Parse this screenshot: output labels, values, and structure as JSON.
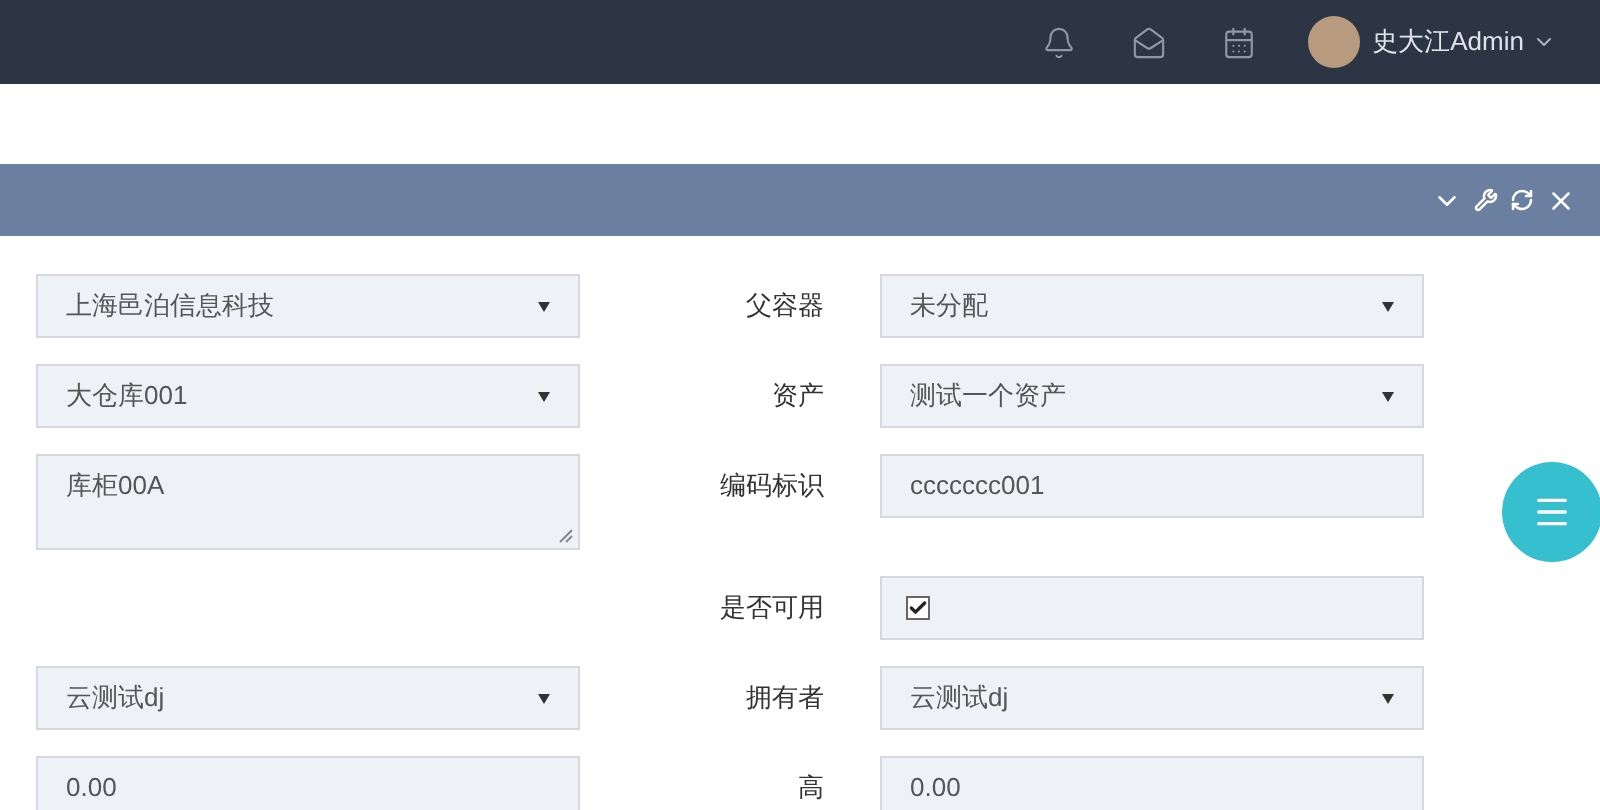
{
  "top_bar": {
    "user_name": "史大江Admin"
  },
  "form": {
    "rows": [
      {
        "left": {
          "kind": "select",
          "value": "上海邑泊信息科技"
        },
        "right": {
          "label": "父容器",
          "kind": "select",
          "value": "未分配"
        }
      },
      {
        "left": {
          "kind": "select",
          "value": "大仓库001"
        },
        "right": {
          "label": "资产",
          "kind": "select",
          "value": "测试一个资产"
        }
      },
      {
        "left": {
          "kind": "textarea",
          "value": "库柜00A"
        },
        "right": {
          "label": "编码标识",
          "kind": "input",
          "value": "ccccccc001"
        }
      },
      {
        "right": {
          "label": "是否可用",
          "kind": "checkbox",
          "checked": true
        }
      },
      {
        "left": {
          "kind": "select",
          "value": "云测试dj"
        },
        "right": {
          "label": "拥有者",
          "kind": "select",
          "value": "云测试dj"
        }
      },
      {
        "left": {
          "kind": "input",
          "value": "0.00"
        },
        "right": {
          "label": "高",
          "kind": "input",
          "value": "0.00"
        }
      }
    ]
  }
}
